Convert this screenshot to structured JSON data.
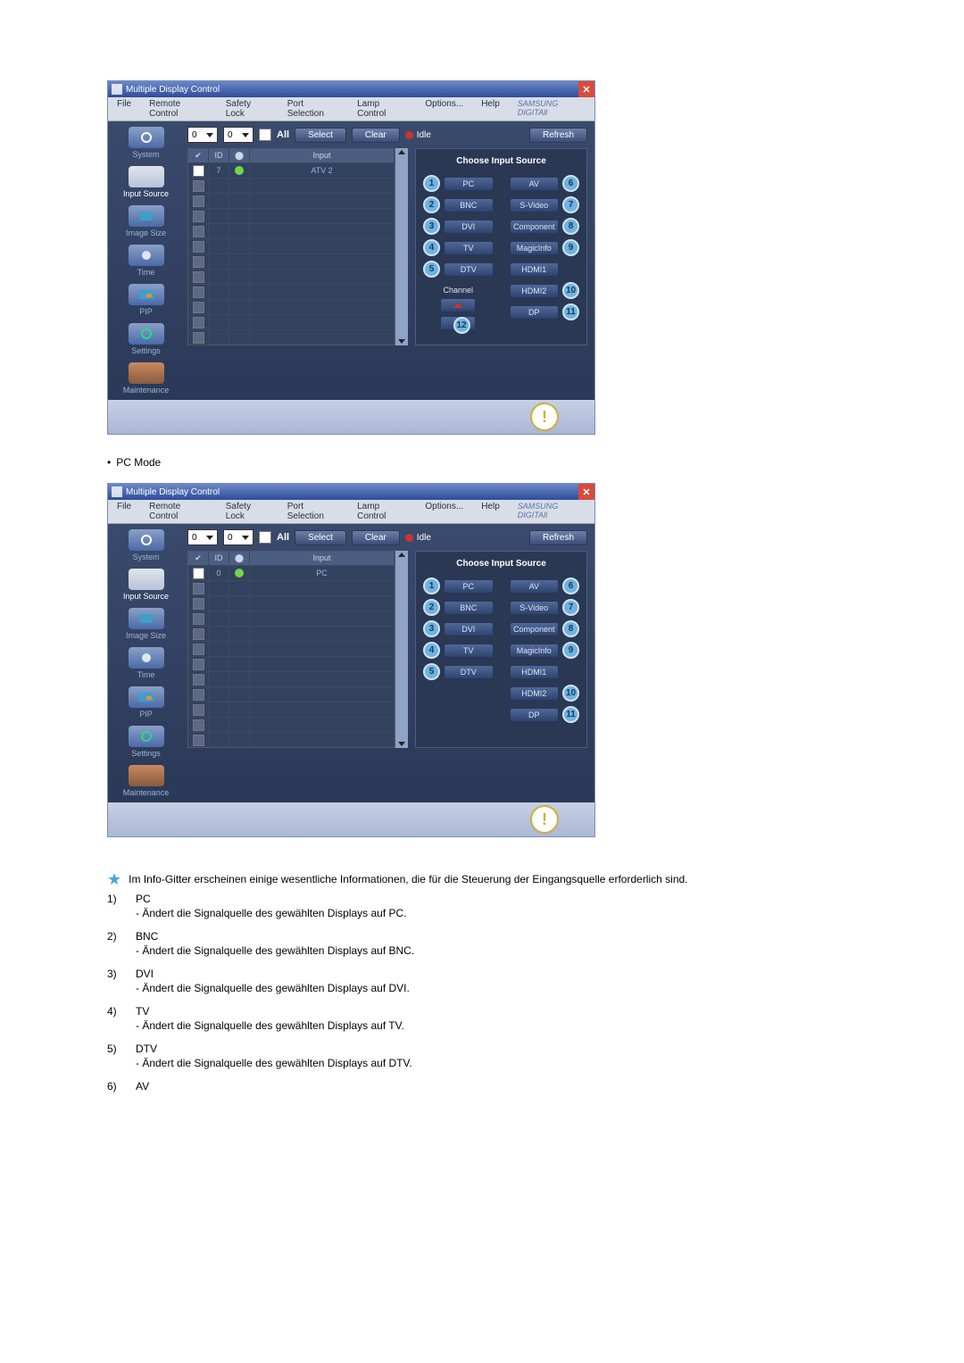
{
  "window": {
    "title": "Multiple Display Control",
    "brand": "SAMSUNG DIGITAll"
  },
  "menu": [
    "File",
    "Remote Control",
    "Safety Lock",
    "Port Selection",
    "Lamp Control",
    "Options...",
    "Help"
  ],
  "sidebar": [
    {
      "label": "System"
    },
    {
      "label": "Input Source",
      "active": true
    },
    {
      "label": "Image Size"
    },
    {
      "label": "Time"
    },
    {
      "label": "PIP"
    },
    {
      "label": "Settings"
    },
    {
      "label": "Maintenance"
    }
  ],
  "toolbar": {
    "spinA": "0",
    "spinB": "0",
    "allLabel": "All",
    "select": "Select",
    "clear": "Clear",
    "idle": "Idle",
    "refresh": "Refresh"
  },
  "grid": {
    "headers": {
      "id": "ID",
      "input": "Input"
    },
    "row1": {
      "id": "7",
      "input": "ATV 2"
    },
    "row2": {
      "id": "0",
      "input": "PC"
    }
  },
  "panel": {
    "title": "Choose Input Source",
    "left": [
      {
        "n": "1",
        "label": "PC"
      },
      {
        "n": "2",
        "label": "BNC"
      },
      {
        "n": "3",
        "label": "DVI"
      },
      {
        "n": "4",
        "label": "TV"
      },
      {
        "n": "5",
        "label": "DTV"
      }
    ],
    "right": [
      {
        "n": "6",
        "label": "AV"
      },
      {
        "n": "7",
        "label": "S-Video"
      },
      {
        "n": "8",
        "label": "Component"
      },
      {
        "n": "9",
        "label": "MagicInfo"
      },
      {
        "n": "10",
        "label": "HDMI1"
      },
      {
        "n": "11",
        "label": "HDMI2"
      },
      {
        "n": "12",
        "label": "DP"
      }
    ],
    "right_pc": [
      {
        "n": "6",
        "label": "AV"
      },
      {
        "n": "7",
        "label": "S-Video"
      },
      {
        "n": "8",
        "label": "Component"
      },
      {
        "n": "9",
        "label": "MagicInfo"
      },
      {
        "n": "10",
        "label": "HDMI1"
      },
      {
        "n": "11",
        "label": "HDMI2"
      },
      {
        "n": "12",
        "label": "DP"
      }
    ],
    "channel": {
      "label": "Channel",
      "badge": "12"
    }
  },
  "caption": {
    "pcmode": "PC Mode"
  },
  "legend": {
    "intro": "Im Info-Gitter erscheinen einige wesentliche Informationen, die für die Steuerung der Eingangsquelle erforderlich sind.",
    "items": [
      {
        "n": "1)",
        "title": "PC",
        "desc": "- Ändert die Signalquelle des gewählten Displays auf PC."
      },
      {
        "n": "2)",
        "title": "BNC",
        "desc": "- Ändert die Signalquelle des gewählten Displays auf BNC."
      },
      {
        "n": "3)",
        "title": "DVI",
        "desc": "- Ändert die Signalquelle des gewählten Displays auf DVI."
      },
      {
        "n": "4)",
        "title": "TV",
        "desc": "- Ändert die Signalquelle des gewählten Displays auf TV."
      },
      {
        "n": "5)",
        "title": "DTV",
        "desc": "- Ändert die Signalquelle des gewählten Displays auf DTV."
      },
      {
        "n": "6)",
        "title": "AV",
        "desc": ""
      }
    ]
  }
}
